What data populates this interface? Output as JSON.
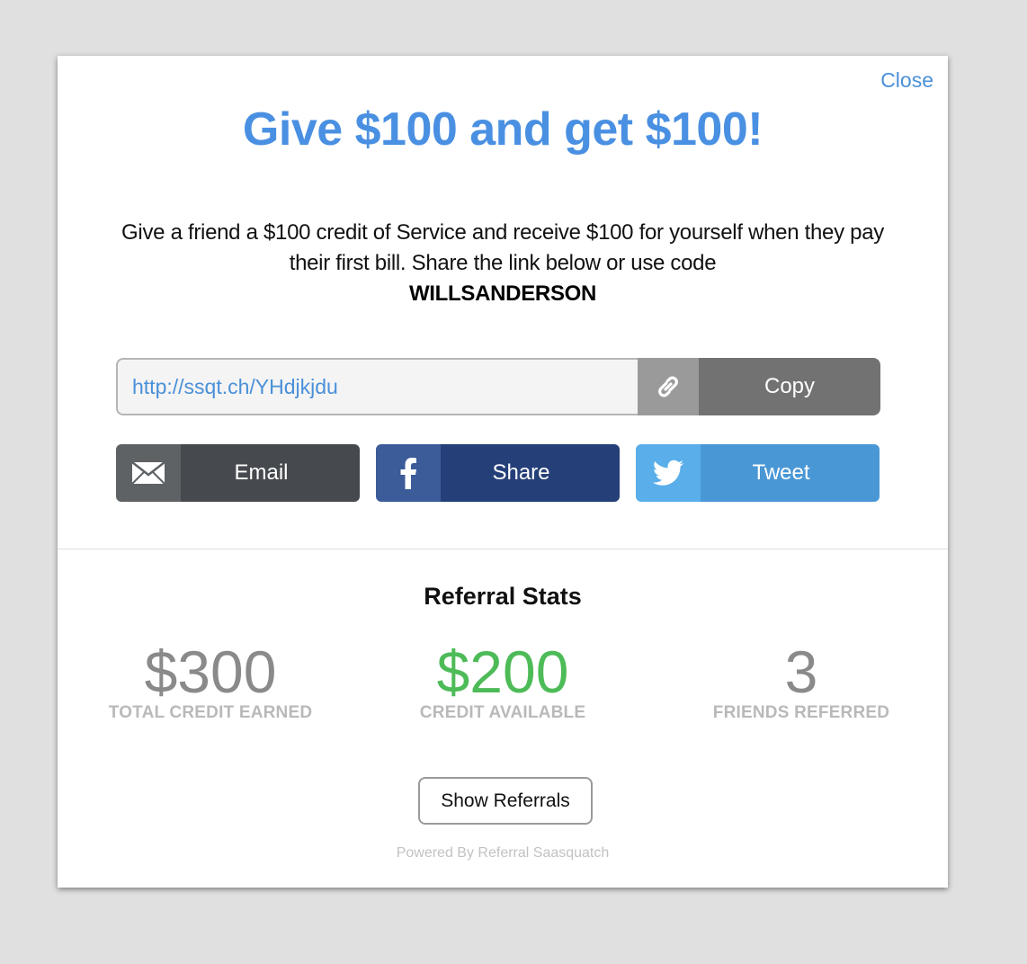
{
  "modal": {
    "close_label": "Close",
    "headline": "Give $100 and get $100!",
    "description": "Give a friend a $100 credit of Service and receive $100 for yourself when they pay their first bill. Share the link below or use code",
    "referral_code": "WILLSANDERSON"
  },
  "share_link": {
    "url": "http://ssqt.ch/YHdjkjdu",
    "link_icon": "link-icon",
    "copy_label": "Copy"
  },
  "share_buttons": [
    {
      "label": "Email",
      "icon": "envelope-icon",
      "colors": {
        "icon_bg": "#5e6265",
        "label_bg": "#464a4e"
      }
    },
    {
      "label": "Share",
      "icon": "facebook-icon",
      "colors": {
        "icon_bg": "#3b5b99",
        "label_bg": "#253f78"
      }
    },
    {
      "label": "Tweet",
      "icon": "twitter-icon",
      "colors": {
        "icon_bg": "#5aaeea",
        "label_bg": "#4a97d6"
      }
    }
  ],
  "stats": {
    "title": "Referral Stats",
    "items": [
      {
        "value": "$300",
        "caption": "TOTAL CREDIT EARNED",
        "color": "#8a8a8a"
      },
      {
        "value": "$200",
        "caption": "CREDIT AVAILABLE",
        "color": "#4dbb57"
      },
      {
        "value": "3",
        "caption": "FRIENDS REFERRED",
        "color": "#8a8a8a"
      }
    ]
  },
  "show_referrals_label": "Show Referrals",
  "powered_by": "Powered By Referral Saasquatch",
  "colors": {
    "accent": "#4a90e2",
    "page_bg": "#e0e0e0"
  }
}
